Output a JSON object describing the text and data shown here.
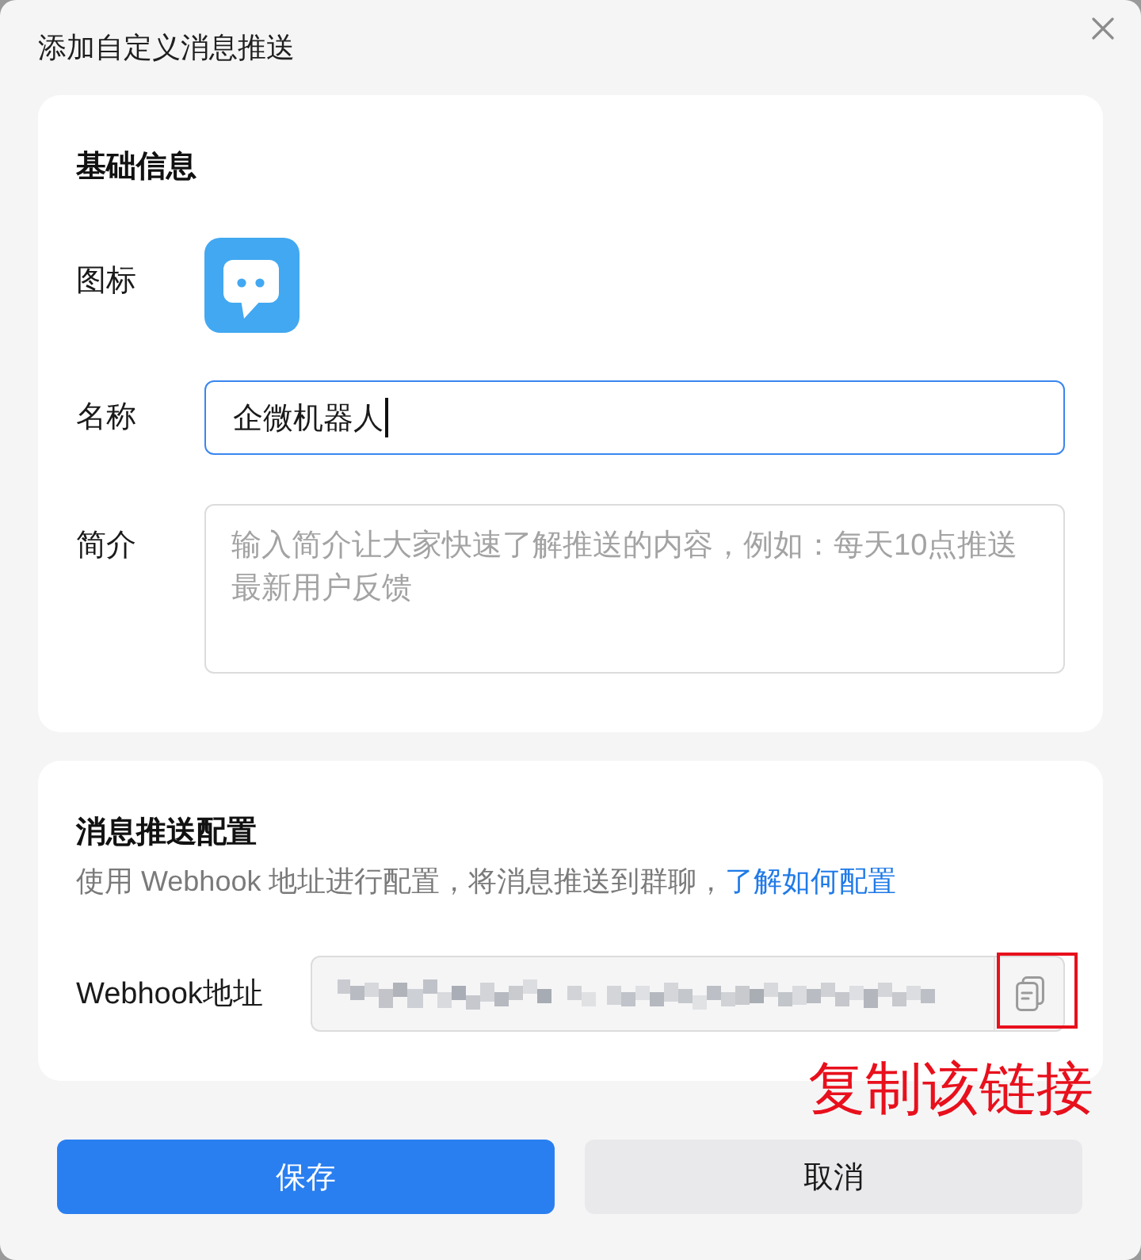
{
  "dialog": {
    "title": "添加自定义消息推送"
  },
  "basic_info": {
    "heading": "基础信息",
    "fields": [
      {
        "kind": "icon",
        "label": "图标"
      },
      {
        "kind": "input",
        "label": "名称",
        "value": "企微机器人",
        "focused": true
      },
      {
        "kind": "textarea",
        "label": "简介",
        "placeholder": "输入简介让大家快速了解推送的内容，例如：每天10点推送最新用户反馈"
      }
    ]
  },
  "push_config": {
    "heading": "消息推送配置",
    "description": "使用 Webhook 地址进行配置，将消息推送到群聊，",
    "link": "了解如何配置",
    "webhook": {
      "label": "Webhook地址"
    }
  },
  "annotation": {
    "text": "复制该链接"
  },
  "buttons": [
    {
      "kind": "primary",
      "label": "保存"
    },
    {
      "kind": "secondary",
      "label": "取消"
    }
  ]
}
